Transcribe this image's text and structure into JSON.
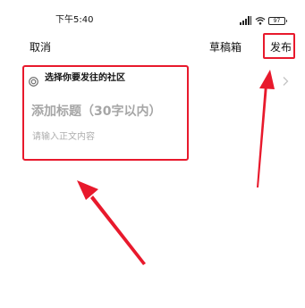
{
  "status_bar": {
    "time": "下午5:40",
    "battery": "97"
  },
  "nav": {
    "cancel_label": "取消",
    "drafts_label": "草稿箱",
    "publish_label": "发布"
  },
  "form": {
    "community_label": "选择你要发往的社区",
    "title_placeholder": "添加标题（30字以内）",
    "body_placeholder": "请输入正文内容"
  },
  "annotations": {
    "highlight_color": "#e8192c"
  }
}
